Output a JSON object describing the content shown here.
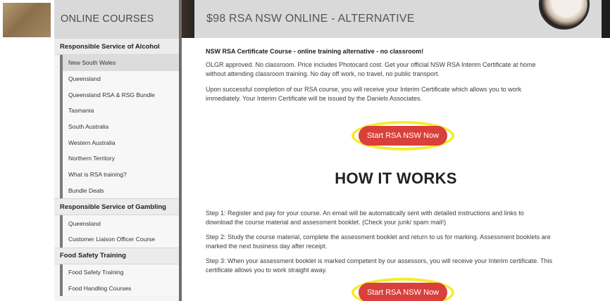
{
  "sidebar": {
    "header": "ONLINE COURSES",
    "sections": [
      {
        "title": "Responsible Service of Alcohol",
        "items": [
          "New South Wales",
          "Queensland",
          "Queensland RSA & RSG Bundle",
          "Tasmania",
          "South Australia",
          "Western Australia",
          "Northern Territory",
          "What is RSA training?",
          "Bundle Deals"
        ],
        "active_index": 0
      },
      {
        "title": "Responsible Service of Gambling",
        "items": [
          "Queensland",
          "Customer Liaison Officer Course"
        ]
      },
      {
        "title": "Food Safety Training",
        "items": [
          "Food Safety Training",
          "Food Handling Courses"
        ]
      }
    ]
  },
  "main": {
    "title": "$98 RSA NSW ONLINE - ALTERNATIVE",
    "lead": "NSW RSA Certificate Course - online training alternative - no classroom!",
    "para1_line1": "OLGR approved. No classroom. Price includes Photocard cost. Get your official NSW RSA  Interim Certificate at home",
    "para1_line2": "without attending classroom training. No day off work, no travel, no public transport.",
    "para2_line1": "Upon successful completion of our RSA course, you will receive your Interim Certificate which allows you to work",
    "para2_line2": "immediately. Your Interim Certificate will be issued by the Daniels Associates.",
    "cta_label": "Start RSA NSW Now",
    "how_title": "HOW IT WORKS",
    "step1_line1": "Step 1: Register and pay for your course. An email will be automatically sent with detailed instructions and links to",
    "step1_line2": "download the course material and assessment booklet. (Check your junk/ spam mail!)",
    "step2_line1": "Step 2: Study the course material, complete the assessment booklet and return to us for marking. Assessment booklets are",
    "step2_line2": "marked the next business day after receipt.",
    "step3_line1": "Step 3: When your assessment booklet is marked competent by our assessors, you will receive your Interim certificate. This",
    "step3_line2": "certificate allows you to work straight away.",
    "cta_label_2": "Start RSA NSW Now"
  },
  "colors": {
    "cta": "#d9403b",
    "highlight_ring": "#f6ec2b",
    "header_bg": "#d9d9d9"
  }
}
